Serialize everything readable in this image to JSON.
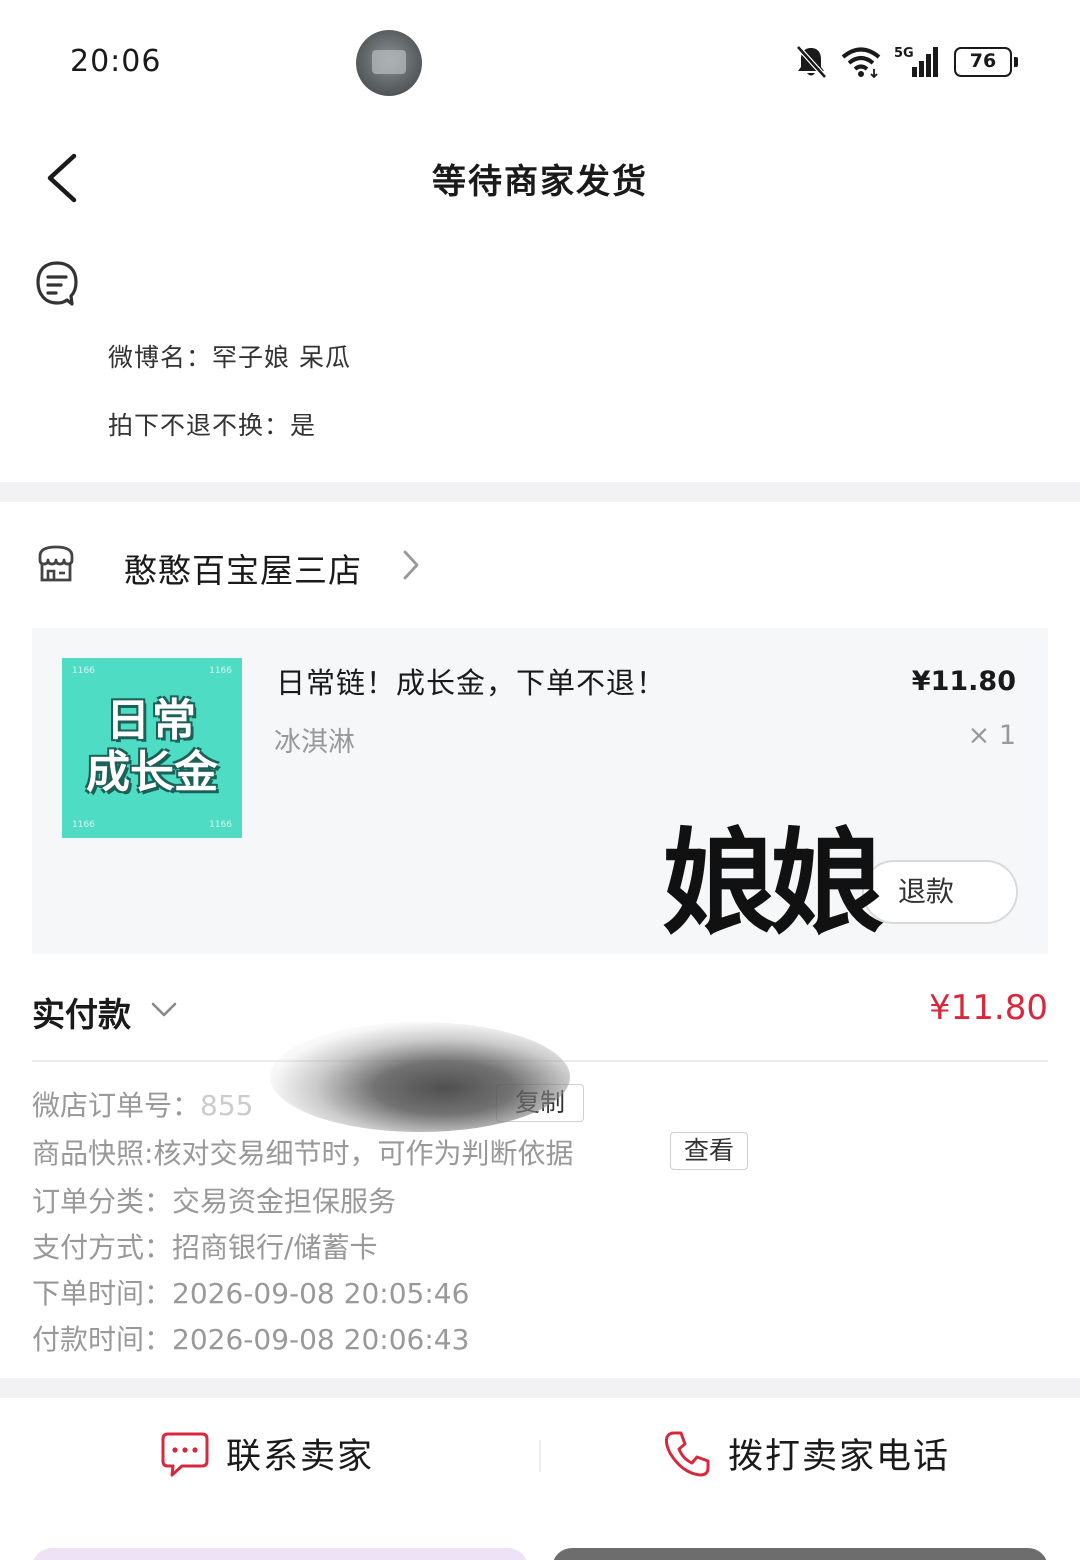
{
  "status_bar": {
    "time": "20:06",
    "network": "5G",
    "battery": "76",
    "icons": [
      "bell-off-icon",
      "wifi-icon",
      "signal-icon",
      "battery-icon"
    ]
  },
  "nav": {
    "title": "等待商家发货",
    "back_icon": "chevron-left-icon"
  },
  "note": {
    "icon": "note-icon",
    "lines": [
      "微博名：罕子娘 呆瓜",
      "拍下不退不换：是"
    ]
  },
  "shop": {
    "name": "憨憨百宝屋三店",
    "icon": "shop-icon"
  },
  "product": {
    "thumb_line1": "日常",
    "thumb_line2": "成长金",
    "name": "日常链！成长金，下单不退！",
    "spec": "冰淇淋",
    "price": "¥11.80",
    "qty": "× 1",
    "refund_label": "退款",
    "sticker_text": "娘娘"
  },
  "total": {
    "label": "实付款",
    "amount": "¥11.80",
    "accent_color": "#d9283c"
  },
  "order_info": {
    "order_no_label": "微店订单号：",
    "order_no_value": "855",
    "copy_label": "复制",
    "snapshot_label": "商品快照:",
    "snapshot_value": "核对交易细节时，可作为判断依据",
    "view_label": "查看",
    "category_label": "订单分类：",
    "category_value": "交易资金担保服务",
    "payment_label": "支付方式：",
    "payment_value": "招商银行/储蓄卡",
    "order_time_label": "下单时间：",
    "order_time_value": "2026-09-08 20:05:46",
    "pay_time_label": "付款时间：",
    "pay_time_value": "2026-09-08 20:06:43"
  },
  "actions": {
    "contact_seller": "联系卖家",
    "call_seller": "拨打卖家电话",
    "icon_color": "#d9283c"
  }
}
